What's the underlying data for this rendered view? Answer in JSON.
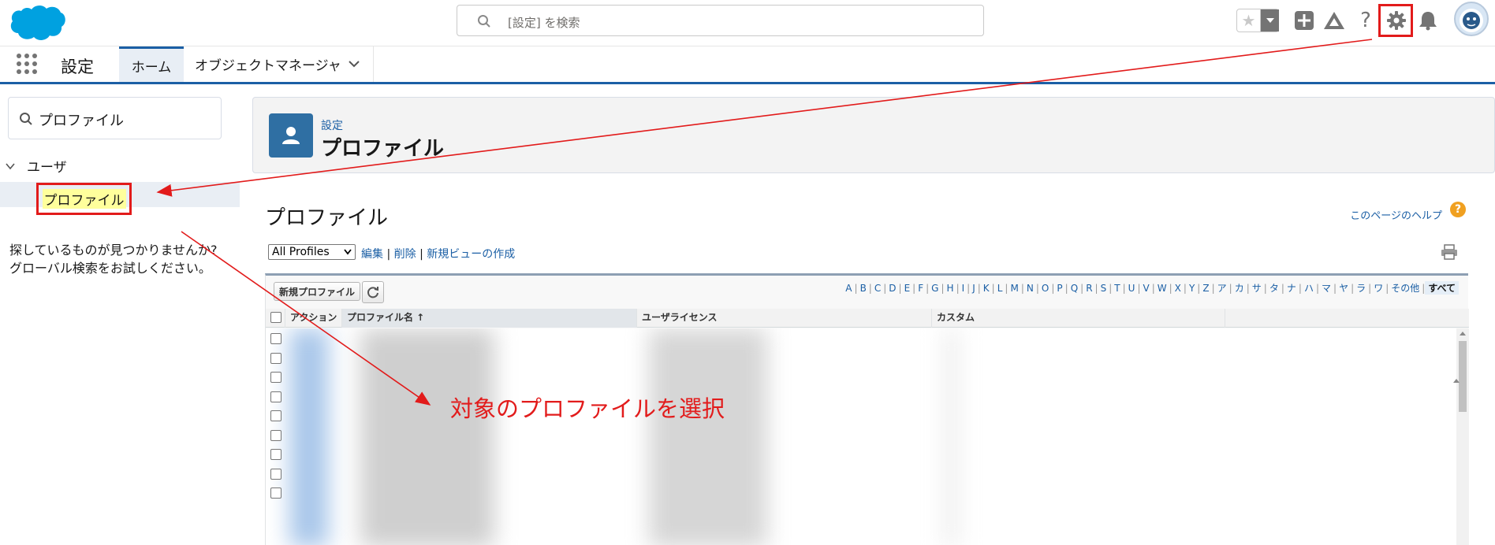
{
  "header": {
    "search_placeholder": "[設定] を検索",
    "icons": [
      "star-icon",
      "chevron-down-icon",
      "plus-icon",
      "trailhead-icon",
      "help-icon",
      "gear-icon",
      "bell-icon",
      "avatar"
    ]
  },
  "context_bar": {
    "app_name": "設定",
    "tabs": [
      {
        "label": "ホーム",
        "active": true
      },
      {
        "label": "オブジェクトマネージャ",
        "active": false
      }
    ]
  },
  "sidebar": {
    "quick_find_value": "プロファイル",
    "tree_parent": "ユーザ",
    "tree_child": "プロファイル",
    "not_found_line1": "探しているものが見つかりませんか?",
    "not_found_line2": "グローバル検索をお試しください。"
  },
  "page_header": {
    "breadcrumb": "設定",
    "title": "プロファイル"
  },
  "list_view": {
    "title": "プロファイル",
    "help_link": "このページのヘルプ",
    "view_selected": "All Profiles",
    "link_edit": "編集",
    "link_delete": "削除",
    "link_new_view": "新規ビューの作成",
    "separator": "|",
    "new_button": "新規プロファイル",
    "alphabet": [
      "A",
      "B",
      "C",
      "D",
      "E",
      "F",
      "G",
      "H",
      "I",
      "J",
      "K",
      "L",
      "M",
      "N",
      "O",
      "P",
      "Q",
      "R",
      "S",
      "T",
      "U",
      "V",
      "W",
      "X",
      "Y",
      "Z",
      "ア",
      "カ",
      "サ",
      "タ",
      "ナ",
      "ハ",
      "マ",
      "ヤ",
      "ラ",
      "ワ",
      "その他",
      "すべて"
    ],
    "columns": [
      "アクション",
      "プロファイル名 ↑",
      "ユーザライセンス",
      "カスタム"
    ],
    "visible_rows": 9
  },
  "annotation": {
    "text": "対象のプロファイルを選択",
    "color": "#e21b1b"
  },
  "colors": {
    "brand_blue": "#1b5fa5",
    "salesforce_cloud": "#00a1e0",
    "highlight_red": "#e21b1b",
    "icon_gray": "#747474"
  }
}
